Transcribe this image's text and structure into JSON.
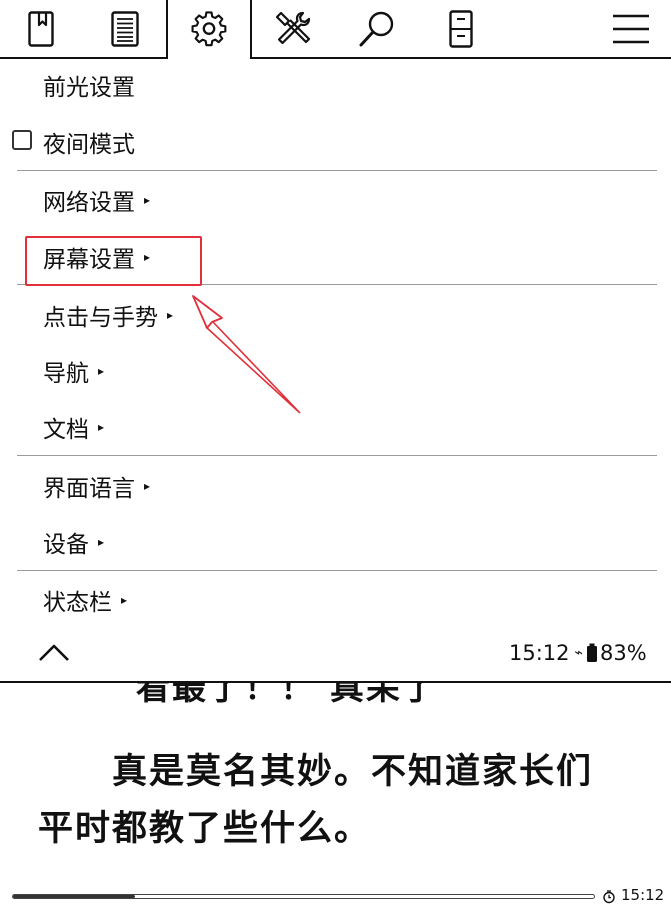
{
  "tabs": [
    {
      "name": "bookmark"
    },
    {
      "name": "toc"
    },
    {
      "name": "settings",
      "active": true
    },
    {
      "name": "tools"
    },
    {
      "name": "search"
    },
    {
      "name": "file"
    },
    {
      "name": "main-menu"
    }
  ],
  "menu": {
    "frontlight": "前光设置",
    "night_mode": "夜间模式",
    "network": "网络设置",
    "screen": "屏幕设置",
    "taps_gestures": "点击与手势",
    "navigation": "导航",
    "document": "文档",
    "ui_language": "界面语言",
    "device": "设备",
    "status_bar": "状态栏",
    "arrow": "▸"
  },
  "status": {
    "time": "15:12",
    "wifi": "⌁",
    "battery": "83%"
  },
  "reader": {
    "cut_line": "看最了！！    真呆了",
    "line1": "真是莫名其妙。不知道家长们",
    "line2": "平时都教了些什么。"
  },
  "footer": {
    "progress": 0.21,
    "time": "15:12"
  },
  "colors": {
    "annotation": "#e0303a",
    "ink": "#111111"
  }
}
